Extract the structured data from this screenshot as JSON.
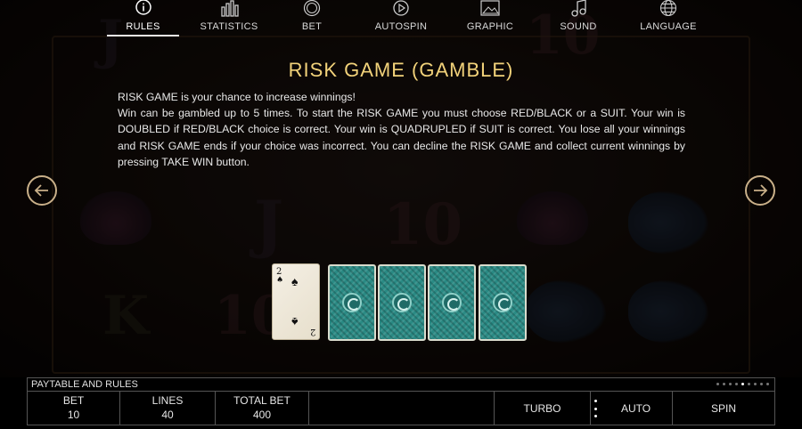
{
  "menu": {
    "items": [
      {
        "label": "RULES",
        "icon": "info-icon",
        "active": true
      },
      {
        "label": "STATISTICS",
        "icon": "bar-chart-icon"
      },
      {
        "label": "BET",
        "icon": "chip-icon"
      },
      {
        "label": "AUTOSPIN",
        "icon": "autospin-icon"
      },
      {
        "label": "GRAPHIC",
        "icon": "image-icon"
      },
      {
        "label": "SOUND",
        "icon": "music-note-icon"
      },
      {
        "label": "LANGUAGE",
        "icon": "globe-icon"
      }
    ]
  },
  "rules": {
    "title": "RISK GAME (GAMBLE)",
    "paragraphs": [
      "RISK GAME is your chance to increase winnings!",
      "Win can be gambled up to 5 times. To start the RISK GAME  you must choose RED/BLACK or a SUIT. Your win is DOUBLED if RED/BLACK choice is correct. Your win is QUADRUPLED if SUIT is correct. You lose all your winnings and RISK GAME ends if your choice was incorrect. You can decline the RISK GAME and collect current winnings by pressing TAKE WIN button."
    ]
  },
  "cards": {
    "open_card": {
      "rank": "2",
      "suit": "♠"
    },
    "face_down_count": 4
  },
  "bottom_bar": {
    "paytable_label": "PAYTABLE AND RULES",
    "page_dots": {
      "total": 9,
      "active_index": 4
    },
    "bet": {
      "label": "BET",
      "value": "10"
    },
    "lines": {
      "label": "LINES",
      "value": "40"
    },
    "total_bet": {
      "label": "TOTAL BET",
      "value": "400"
    },
    "turbo_label": "TURBO",
    "auto_label": "AUTO",
    "spin_label": "SPIN"
  },
  "colors": {
    "title": "#f2d27a",
    "arrow_border": "#c9b089",
    "card_back": "#2a8a84"
  }
}
